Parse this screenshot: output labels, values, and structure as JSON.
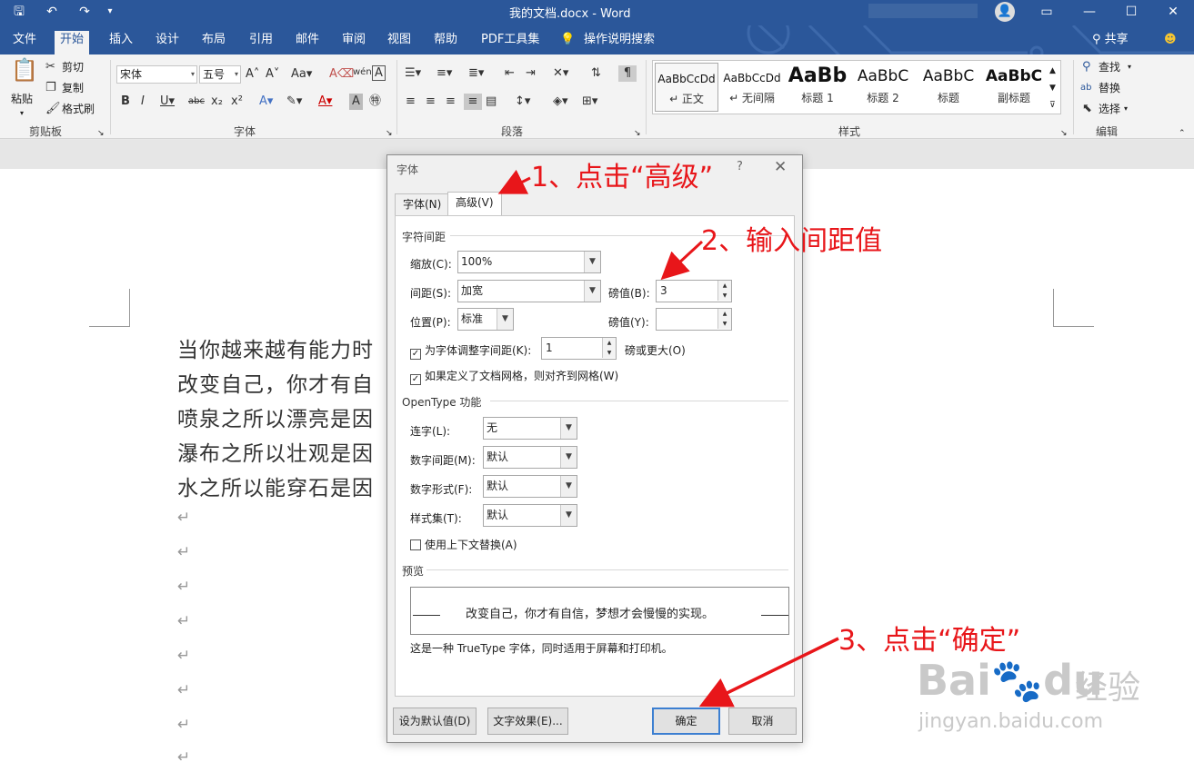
{
  "titlebar": {
    "title": "我的文档.docx  -  Word",
    "qa_save": "🖫",
    "qa_undo": "↶",
    "qa_redo": "↷",
    "qa_more": "▾"
  },
  "tabs": [
    "文件",
    "开始",
    "插入",
    "设计",
    "布局",
    "引用",
    "邮件",
    "审阅",
    "视图",
    "帮助",
    "PDF工具集",
    "操作说明搜索"
  ],
  "share_label": "共享",
  "ribbon": {
    "clipboard": {
      "paste": "粘贴",
      "cut": "剪切",
      "copy": "复制",
      "format_painter": "格式刷",
      "label": "剪贴板"
    },
    "font": {
      "font_name": "宋体",
      "font_size": "五号",
      "label": "字体"
    },
    "paragraph": {
      "label": "段落"
    },
    "styles": {
      "label": "样式",
      "items": [
        {
          "preview": "AaBbCcDd",
          "name": "↵ 正文"
        },
        {
          "preview": "AaBbCcDd",
          "name": "↵ 无间隔"
        },
        {
          "preview": "AaBb",
          "name": "标题 1"
        },
        {
          "preview": "AaBbC",
          "name": "标题 2"
        },
        {
          "preview": "AaBbC",
          "name": "标题"
        },
        {
          "preview": "AaBbC",
          "name": "副标题"
        }
      ]
    },
    "editing": {
      "find": "查找",
      "replace": "替换",
      "select": "选择",
      "label": "编辑"
    }
  },
  "document": {
    "lines": [
      "当你越来越有能力时",
      "改变自己，你才有自",
      "喷泉之所以漂亮是因",
      "瀑布之所以壮观是因",
      "水之所以能穿石是因"
    ],
    "pilcrow": "↵"
  },
  "dialog": {
    "title": "字体",
    "help": "?",
    "close": "✕",
    "tab_font": "字体(N)",
    "tab_advanced": "高级(V)",
    "spacing_section": "字符间距",
    "scale_label": "缩放(C):",
    "scale_value": "100%",
    "spacing_label": "间距(S):",
    "spacing_value": "加宽",
    "spacing_by_label": "磅值(B):",
    "spacing_by_value": "3",
    "position_label": "位置(P):",
    "position_value": "标准",
    "position_by_label": "磅值(Y):",
    "position_by_value": "",
    "kerning_label": "为字体调整字间距(K):",
    "kerning_value": "1",
    "kerning_suffix": "磅或更大(O)",
    "grid_label": "如果定义了文档网格，则对齐到网格(W)",
    "opentype_section": "OpenType 功能",
    "ligatures_label": "连字(L):",
    "ligatures_value": "无",
    "num_spacing_label": "数字间距(M):",
    "num_spacing_value": "默认",
    "num_forms_label": "数字形式(F):",
    "num_forms_value": "默认",
    "stylistic_label": "样式集(T):",
    "stylistic_value": "默认",
    "contextual_label": "使用上下文替换(A)",
    "preview_section": "预览",
    "preview_text": "改变自己，你才有自信，梦想才会慢慢的实现。",
    "note": "这是一种 TrueType 字体，同时适用于屏幕和打印机。",
    "btn_default": "设为默认值(D)",
    "btn_effects": "文字效果(E)...",
    "btn_ok": "确定",
    "btn_cancel": "取消"
  },
  "annotations": {
    "step1": "1、点击“高级”",
    "step2": "2、输入间距值",
    "step3": "3、点击“确定”",
    "color": "#e8161a"
  },
  "watermark": {
    "brand": "Bai",
    "brand2": "du",
    "cn": "经验",
    "url": "jingyan.baidu.com"
  }
}
